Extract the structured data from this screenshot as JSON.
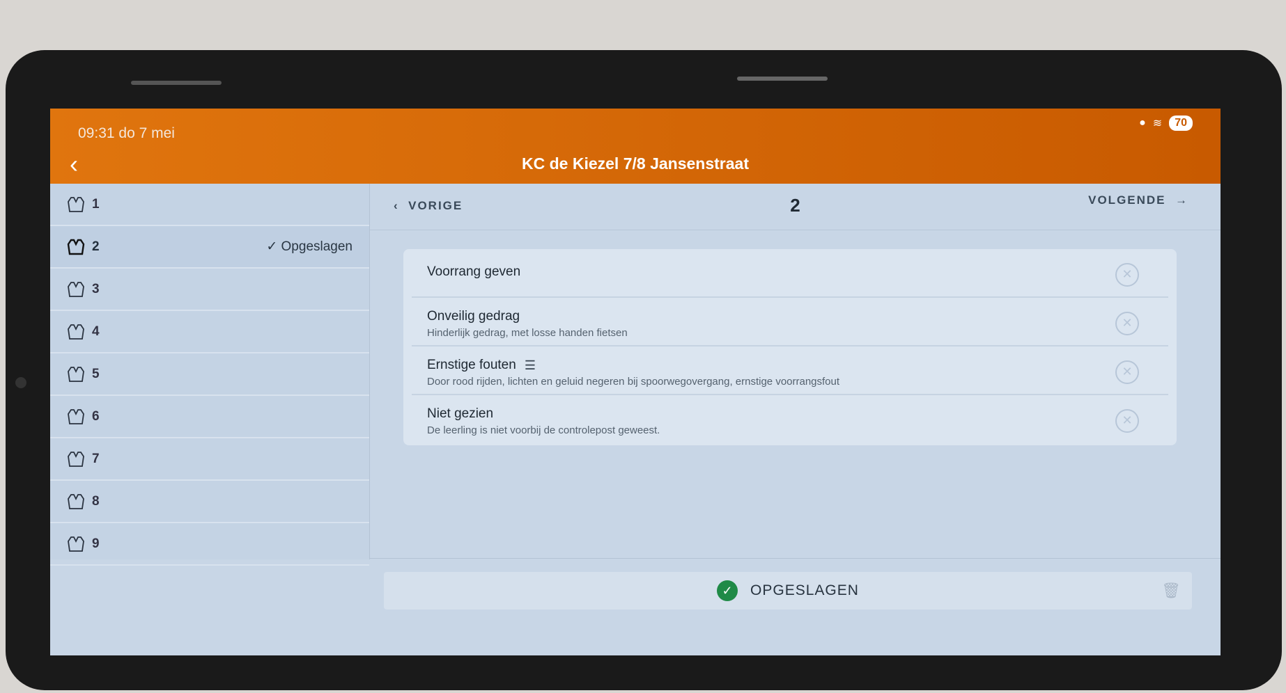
{
  "status": {
    "time": "09:31   do 7 mei",
    "battery": "70"
  },
  "appbar": {
    "title": "KC de Kiezel 7/8 Jansenstraat"
  },
  "sidebar": {
    "items": [
      {
        "label": "1",
        "status": ""
      },
      {
        "label": "2",
        "status": "✓ Opgeslagen"
      },
      {
        "label": "3",
        "status": ""
      },
      {
        "label": "4",
        "status": ""
      },
      {
        "label": "5",
        "status": ""
      },
      {
        "label": "6",
        "status": ""
      },
      {
        "label": "7",
        "status": ""
      },
      {
        "label": "8",
        "status": ""
      },
      {
        "label": "9",
        "status": ""
      }
    ]
  },
  "nav": {
    "prev": "VORIGE",
    "title": "2",
    "next": "VOLGENDE"
  },
  "items": [
    {
      "title": "Voorrang geven",
      "subtitle": ""
    },
    {
      "title": "Onveilig gedrag",
      "subtitle": "Hinderlijk gedrag, met losse handen fietsen"
    },
    {
      "title": "Ernstige fouten",
      "subtitle": "Door rood rijden, lichten en geluid negeren bij spoorwegovergang, ernstige voorrangsfout"
    },
    {
      "title": "Niet gezien",
      "subtitle": "De leerling is niet voorbij de controlepost geweest."
    }
  ],
  "footer": {
    "save_label": "OPGESLAGEN"
  },
  "icons": {
    "sidebar": "safety-vest-icon",
    "remove": "close-circle-icon",
    "list": "list-icon",
    "saved": "check-circle-icon",
    "delete": "trash-icon"
  },
  "colors": {
    "appbar": "#e0750e",
    "saved": "#1f8a47"
  }
}
